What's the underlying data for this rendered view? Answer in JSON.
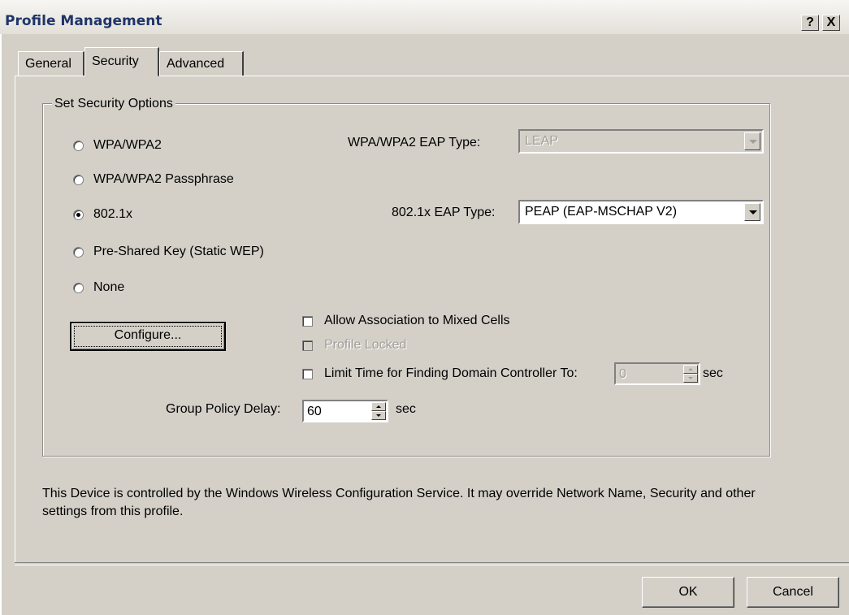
{
  "window": {
    "title": "Profile Management",
    "help_button": "?",
    "close_button": "X"
  },
  "tabs": [
    {
      "label": "General",
      "active": false
    },
    {
      "label": "Security",
      "active": true
    },
    {
      "label": "Advanced",
      "active": false
    }
  ],
  "security": {
    "group_title": "Set Security Options",
    "options": [
      {
        "label": "WPA/WPA2",
        "selected": false
      },
      {
        "label": "WPA/WPA2 Passphrase",
        "selected": false
      },
      {
        "label": "802.1x",
        "selected": true
      },
      {
        "label": "Pre-Shared Key (Static WEP)",
        "selected": false
      },
      {
        "label": "None",
        "selected": false
      }
    ],
    "wpa_eap_type": {
      "label": "WPA/WPA2 EAP Type:",
      "value": "LEAP",
      "enabled": false
    },
    "dot1x_eap_type": {
      "label": "802.1x EAP Type:",
      "value": "PEAP (EAP-MSCHAP V2)",
      "enabled": true
    },
    "configure_button": "Configure...",
    "checkboxes": [
      {
        "label": "Allow Association to Mixed Cells",
        "checked": false,
        "enabled": true
      },
      {
        "label": "Profile Locked",
        "checked": false,
        "enabled": false
      },
      {
        "label": "Limit Time for Finding Domain Controller To:",
        "checked": false,
        "enabled": true
      }
    ],
    "domain_timeout": {
      "value": "0",
      "unit": "sec",
      "enabled": false
    },
    "group_policy_delay": {
      "label": "Group Policy Delay:",
      "value": "60",
      "unit": "sec"
    }
  },
  "notice": "This Device is controlled by the Windows Wireless Configuration Service. It may override Network Name, Security and other settings from this profile.",
  "buttons": {
    "ok": "OK",
    "cancel": "Cancel"
  },
  "colors": {
    "title_text": "#1f3569",
    "dialog_bg": "#d4d0c8",
    "disabled_text": "#a09e98"
  }
}
